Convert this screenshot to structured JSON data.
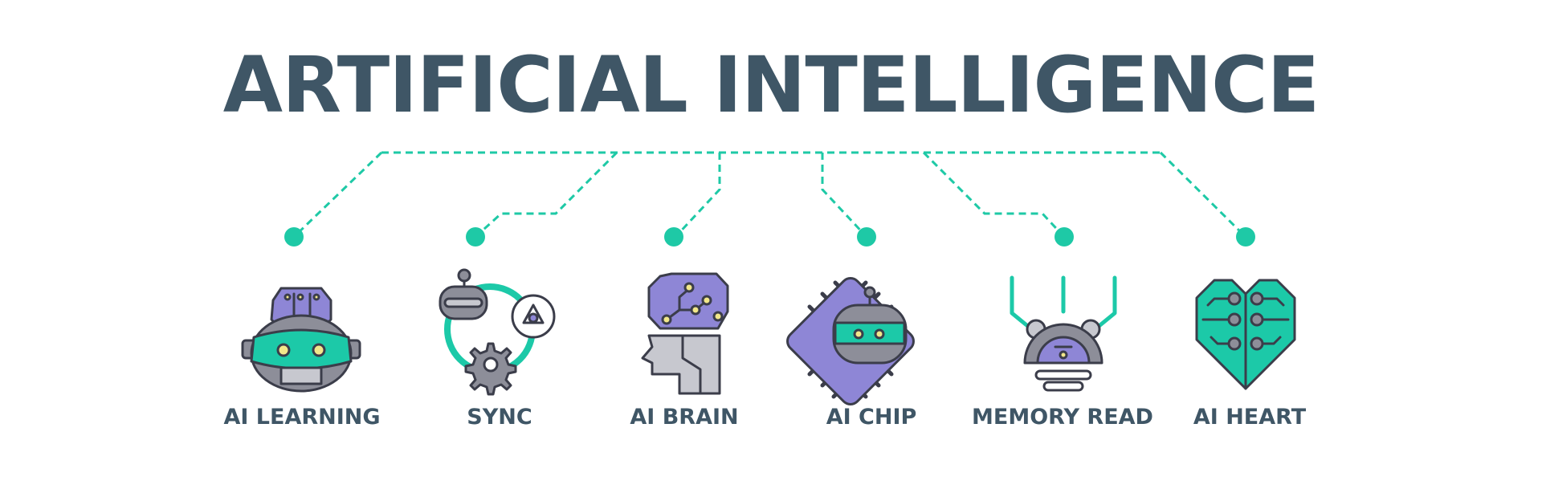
{
  "title": "ARTIFICIAL INTELLIGENCE",
  "colors": {
    "title_text": "#3f5666",
    "connector": "#1ec9a6",
    "purple": "#8e86d6",
    "teal": "#1cc9a8",
    "gray": "#8d8e99",
    "outline": "#3b3d4a"
  },
  "items": [
    {
      "label": "AI LEARNING",
      "icon": "robot-head-brain-icon"
    },
    {
      "label": "SYNC",
      "icon": "robot-sync-gear-icon"
    },
    {
      "label": "AI BRAIN",
      "icon": "head-circuit-brain-icon"
    },
    {
      "label": "AI CHIP",
      "icon": "robot-chip-icon"
    },
    {
      "label": "MEMORY READ",
      "icon": "robot-memory-read-icon"
    },
    {
      "label": "AI HEART",
      "icon": "circuit-heart-icon"
    }
  ]
}
